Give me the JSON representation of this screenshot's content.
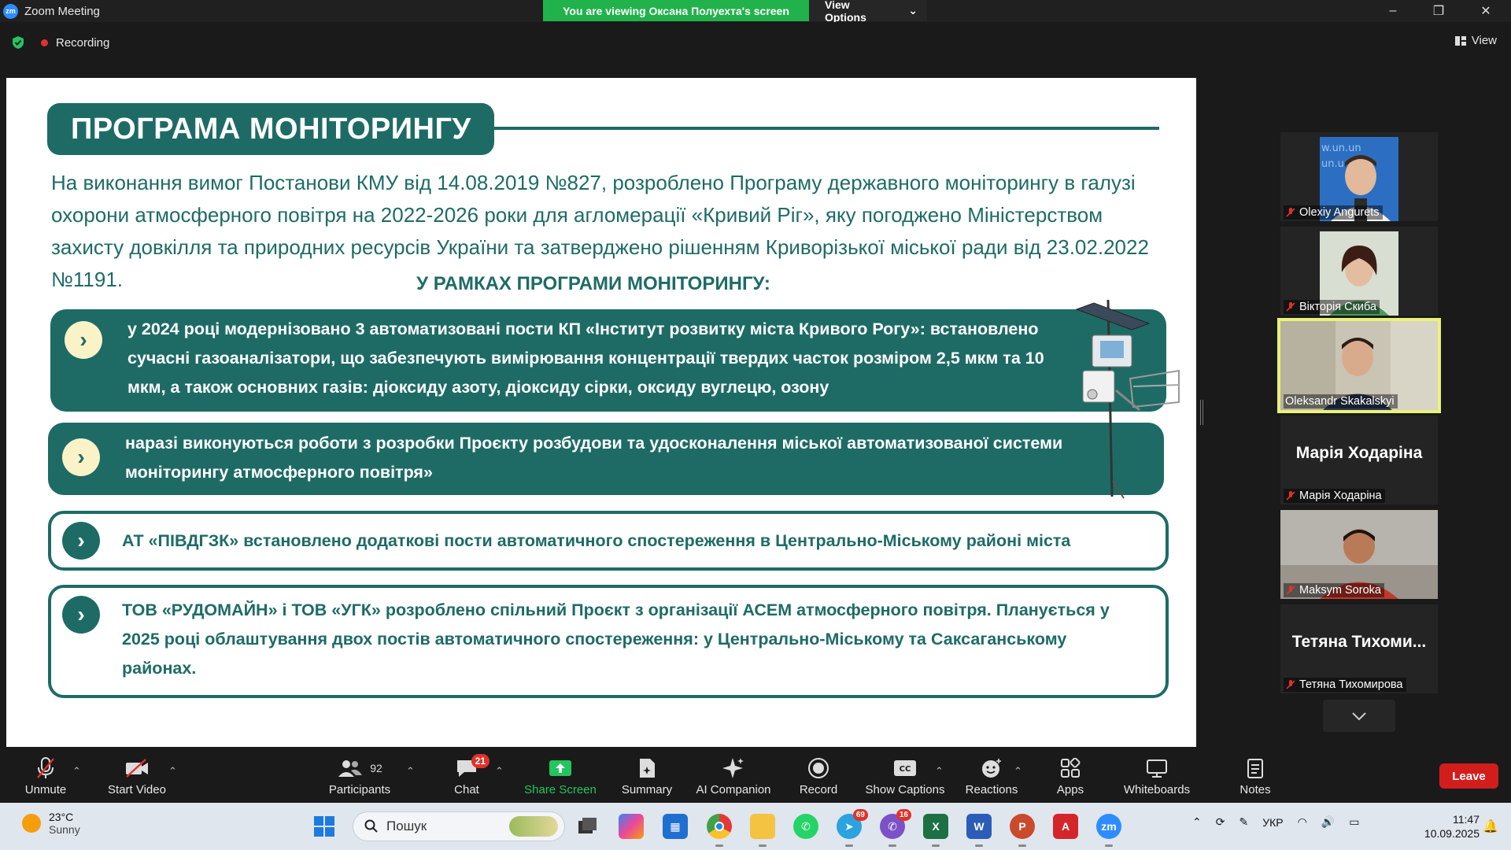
{
  "window": {
    "title": "Zoom Meeting",
    "banner_message": "You are viewing Оксана Полуехта's screen",
    "view_options": "View Options"
  },
  "recording": {
    "label": "Recording",
    "view_label": "View"
  },
  "slide": {
    "title": "ПРОГРАМА МОНІТОРИНГУ",
    "intro": "На виконання вимог Постанови КМУ від 14.08.2019 №827, розроблено Програму державного моніторингу в галузі охорони атмосферного повітря на 2022-2026 роки для агломерації «Кривий Ріг», яку погоджено Міністерством захисту довкілля та природних ресурсів України та затверджено рішенням Криворізької міської ради від 23.02.2022 №1191.",
    "subheading": "У РАМКАХ ПРОГРАМИ МОНІТОРИНГУ:",
    "items": [
      "у 2024 році модернізовано 3 автоматизовані пости КП «Інститут розвитку міста Кривого Рогу»: встановлено сучасні газоаналізатори, що забезпечують вимірювання концентрації твердих часток розміром 2,5 мкм та 10 мкм, а також основних газів: діоксиду азоту, діоксиду сірки, оксиду вуглецю, озону",
      "наразі виконуються роботи з розробки Проєкту розбудови та удосконалення міської автоматизованої системи моніторингу атмосферного повітря»",
      "АТ «ПІВДГЗК» встановлено додаткові пости автоматичного спостереження в Центрально-Міському районі міста",
      "ТОВ «РУДОМАЙН» і ТОВ «УГК» розроблено спільний Проєкт з організації АСЕМ атмосферного повітря. Планується у 2025 році облаштування двох постів автоматичного спостереження: у Центрально-Міському та Саксаганському районах."
    ]
  },
  "participants": [
    {
      "name": "Olexiy Angurets"
    },
    {
      "name": "Вікторія Скиба"
    },
    {
      "name": "Oleksandr Skakalskyi"
    },
    {
      "name": "Марія Ходаріна",
      "big": "Марія Ходаріна"
    },
    {
      "name": "Maksym Soroka"
    },
    {
      "name": "Тетяна Тихомирова",
      "big": "Тетяна Тихоми..."
    }
  ],
  "toolbar": {
    "unmute": "Unmute",
    "start_video": "Start Video",
    "participants": "Participants",
    "participants_count": "92",
    "chat": "Chat",
    "chat_badge": "21",
    "share_screen": "Share Screen",
    "summary": "Summary",
    "ai_companion": "AI Companion",
    "record": "Record",
    "show_captions": "Show Captions",
    "reactions": "Reactions",
    "apps": "Apps",
    "whiteboards": "Whiteboards",
    "notes": "Notes",
    "leave": "Leave"
  },
  "taskbar": {
    "temperature": "23°C",
    "weather": "Sunny",
    "search_placeholder": "Пошук",
    "telegram_badge": "69",
    "viber_badge": "16",
    "lang": "УКР",
    "time": "11:47",
    "date": "10.09.2025"
  },
  "colors": {
    "accent": "#1e6b66",
    "zoom_blue": "#2D8CFF",
    "banner_green": "#22b24c",
    "leave_red": "#d21d1d",
    "active_tile": "#e9f27a"
  }
}
